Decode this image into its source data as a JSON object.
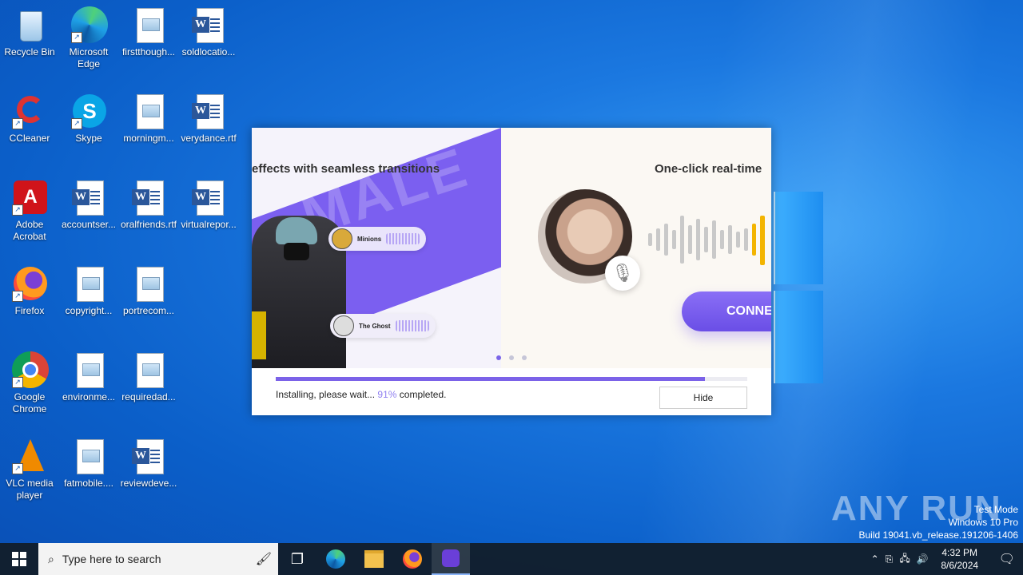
{
  "desktop": {
    "icons": [
      {
        "label": "Recycle Bin"
      },
      {
        "label": "Microsoft Edge"
      },
      {
        "label": "firstthough..."
      },
      {
        "label": "soldlocatio..."
      },
      {
        "label": "CCleaner"
      },
      {
        "label": "Skype"
      },
      {
        "label": "morningm..."
      },
      {
        "label": "verydance.rtf"
      },
      {
        "label": "Adobe Acrobat"
      },
      {
        "label": "accountser..."
      },
      {
        "label": "oralfriends.rtf"
      },
      {
        "label": "virtualrepor..."
      },
      {
        "label": "Firefox"
      },
      {
        "label": "copyright..."
      },
      {
        "label": "portrecom..."
      },
      {
        "label": "Google Chrome"
      },
      {
        "label": "environme..."
      },
      {
        "label": "requiredad..."
      },
      {
        "label": "VLC media player"
      },
      {
        "label": "fatmobile...."
      },
      {
        "label": "reviewdeve..."
      }
    ]
  },
  "installer": {
    "slide_left_headline": "effects with seamless transitions",
    "slide_left_bg_text": "MALE",
    "voice1": "Minions",
    "voice2": "The Ghost",
    "slide_right_headline": "One-click real-time",
    "connect_label": "CONNE",
    "progress_fraction": 0.91,
    "status_prefix": "Installing, please wait... ",
    "status_percent": "91%",
    "status_suffix": " completed.",
    "hide_label": "Hide",
    "accent": "#7b62e8"
  },
  "watermark": "ANY RUN",
  "test_mode": {
    "line1": "Test Mode",
    "line2": "Windows 10 Pro",
    "line3": "Build 19041.vb_release.191206-1406"
  },
  "taskbar": {
    "search_placeholder": "Type here to search",
    "time": "4:32 PM",
    "date": "8/6/2024"
  }
}
